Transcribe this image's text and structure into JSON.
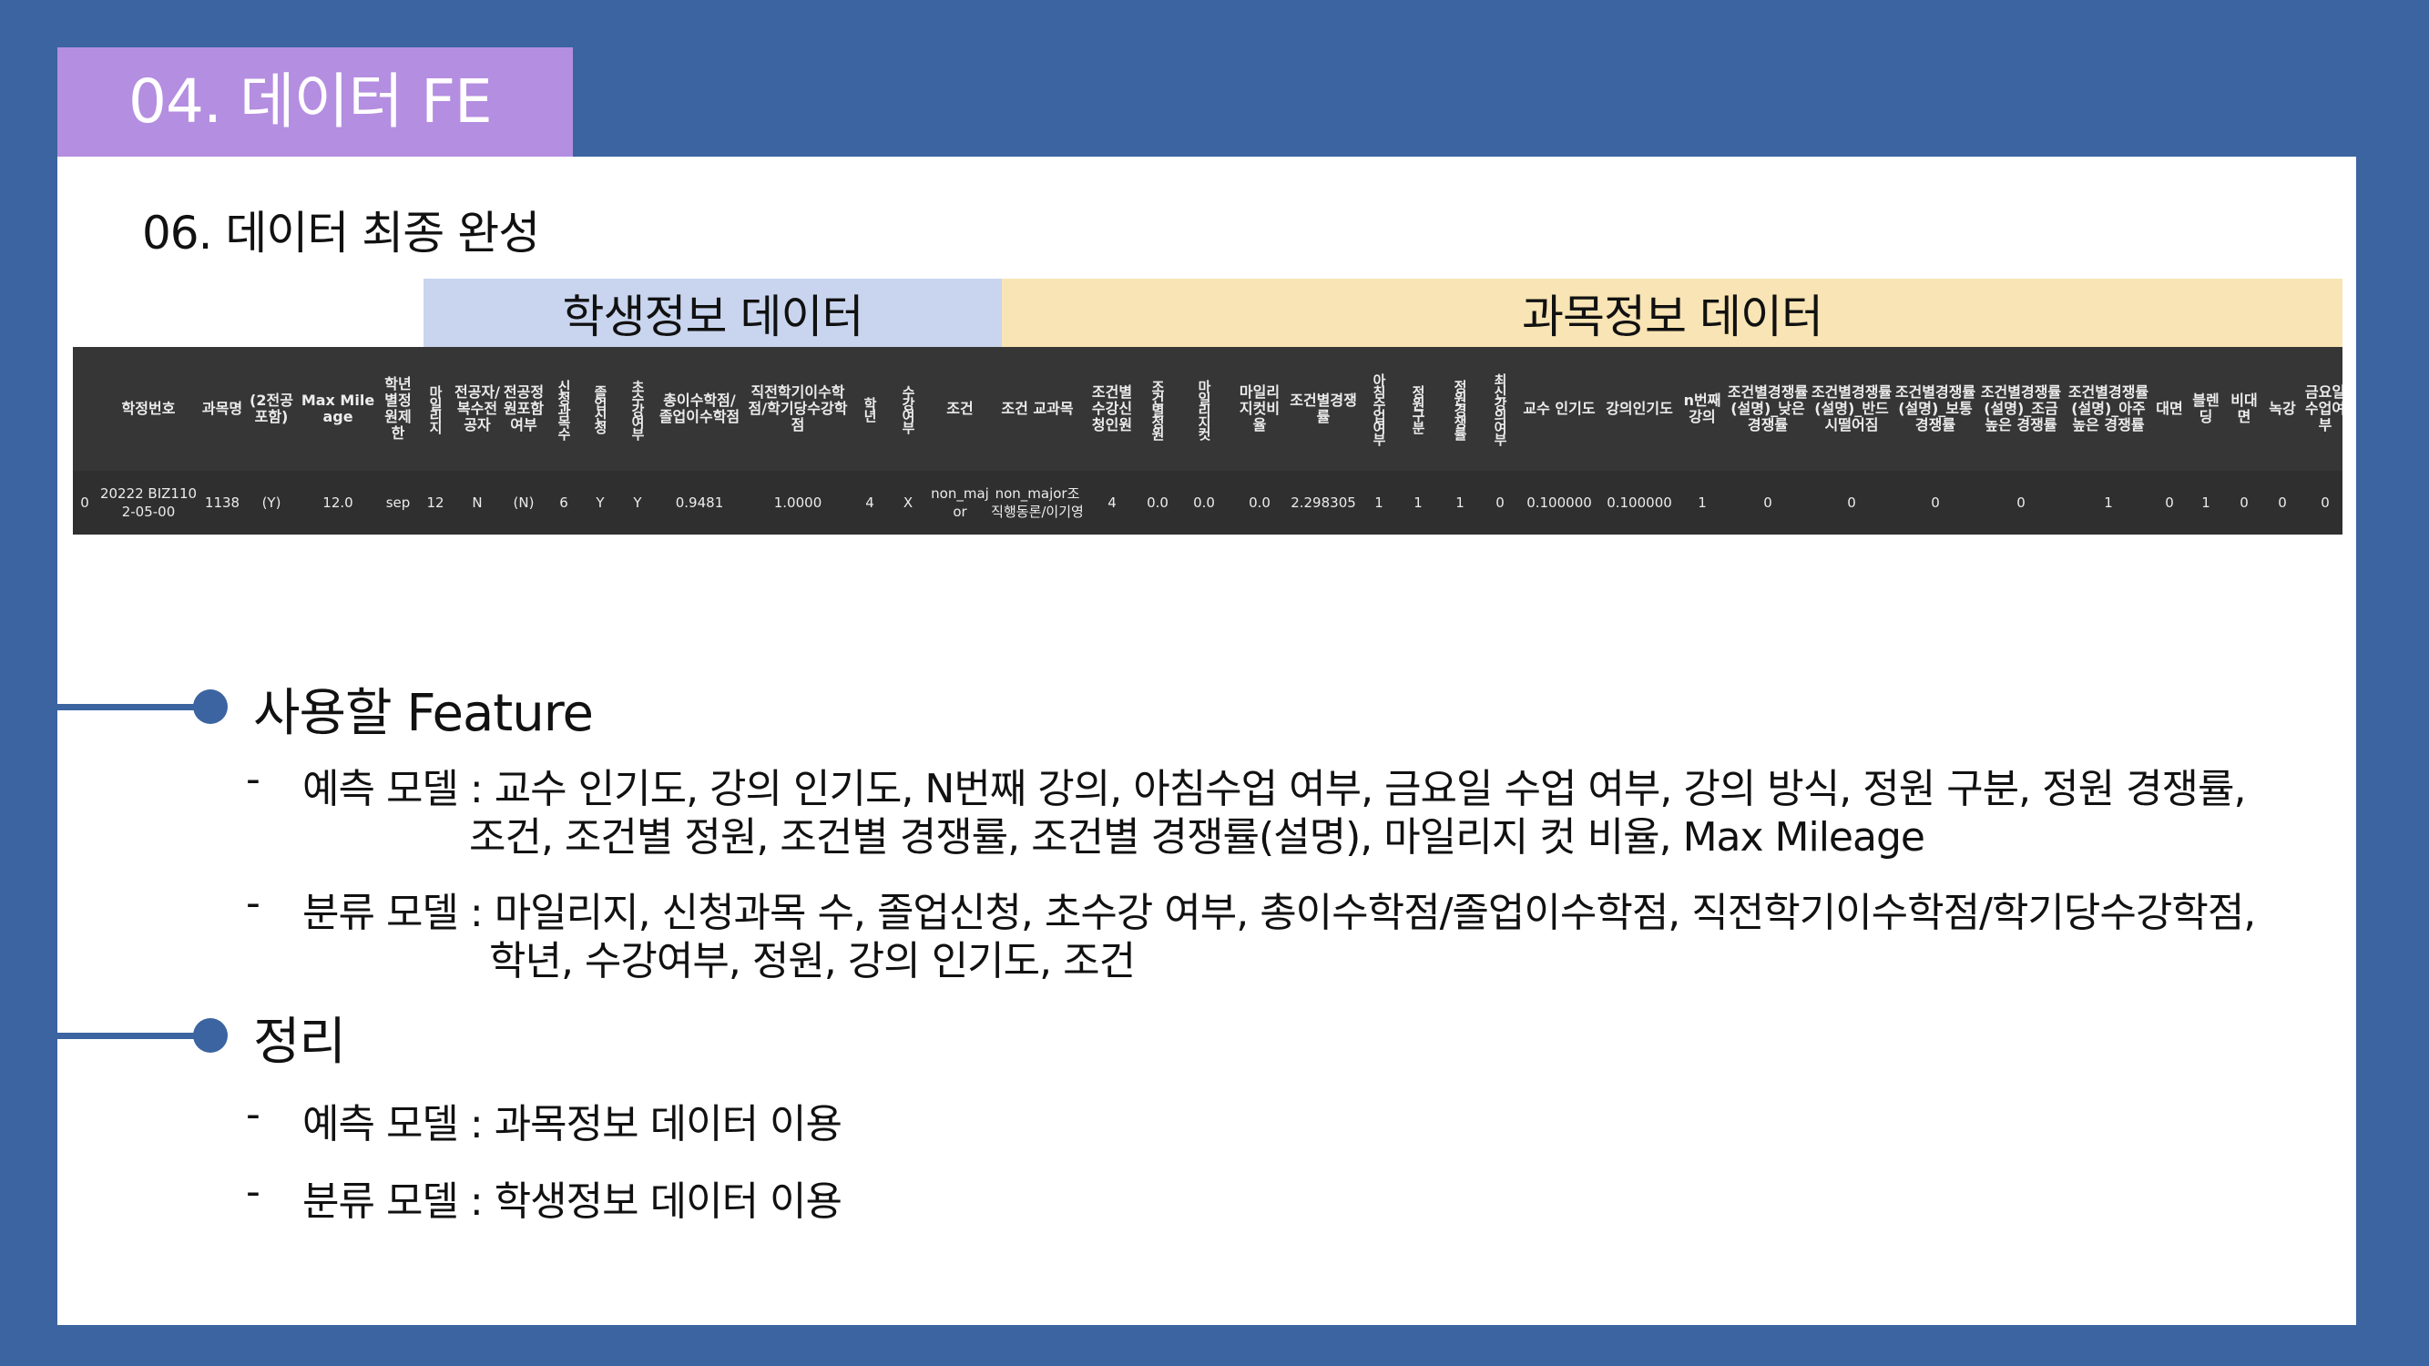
{
  "section_title": "04. 데이터 FE",
  "subtitle": "06.  데이터 최종 완성",
  "band_student": "학생정보 데이터",
  "band_course": "과목정보 데이터",
  "table": {
    "headers": [
      "",
      "학정번호",
      "과목명",
      "(2전공포함)",
      "Max Mileage",
      "학년별정원제한",
      "마일리지",
      "전공자/복수전공자",
      "전공정원포함여부",
      "신청과목수",
      "졸업신청",
      "초수강여부",
      "총이수학점/졸업이수학점",
      "직전학기이수학점/학기당수강학점",
      "학년",
      "수강여부",
      "조건",
      "조건 교과목",
      "조건별수강신청인원",
      "조건별정원",
      "마일리지컷",
      "마일리지컷비율",
      "조건별경쟁률",
      "아침수업여부",
      "정원구분",
      "정원경쟁률",
      "최신강의여부",
      "교수 인기도",
      "강의인기도",
      "n번째강의",
      "조건별경쟁률(설명)_낮은 경쟁률",
      "조건별경쟁률(설명)_반드시떨어짐",
      "조건별경쟁률(설명)_보통 경쟁률",
      "조건별경쟁률(설명)_조금 높은 경쟁률",
      "조건별경쟁률(설명)_아주 높은 경쟁률",
      "대면",
      "블렌딩",
      "비대면",
      "녹강",
      "금요일수업여부"
    ],
    "row": [
      "0",
      "20222 BIZ1102-05-00",
      "1138",
      "(Y)",
      "12.0",
      "sep",
      "12",
      "N",
      "(N)",
      "6",
      "Y",
      "Y",
      "0.9481",
      "1.0000",
      "4",
      "X",
      "non_major",
      "non_major조직행동론/이기영",
      "4",
      "0.0",
      "0.0",
      "0.0",
      "2.298305",
      "1",
      "1",
      "1",
      "0",
      "0.100000",
      "0.100000",
      "1",
      "0",
      "0",
      "0",
      "0",
      "1",
      "0",
      "1",
      "0",
      "0",
      "0"
    ]
  },
  "feature_heading": "사용할 Feature",
  "feature_items": [
    {
      "dash": "-",
      "label": "예측 모델 : ",
      "line1": "교수 인기도, 강의 인기도, N번째 강의, 아침수업 여부, 금요일 수업 여부, 강의 방식, 정원 구분, 정원 경쟁률,",
      "line2": "조건, 조건별 정원, 조건별 경쟁률, 조건별 경쟁률(설명), 마일리지 컷 비율, Max Mileage"
    },
    {
      "dash": "-",
      "label": "분류 모델 : ",
      "line1": "마일리지, 신청과목 수, 졸업신청, 초수강 여부, 총이수학점/졸업이수학점, 직전학기이수학점/학기당수강학점,",
      "line2": "학년, 수강여부, 정원, 강의 인기도, 조건"
    }
  ],
  "summary_heading": "정리",
  "summary_items": [
    {
      "dash": "-",
      "text": "예측 모델 : 과목정보 데이터 이용"
    },
    {
      "dash": "-",
      "text": "분류 모델 : 학생정보 데이터 이용"
    }
  ]
}
